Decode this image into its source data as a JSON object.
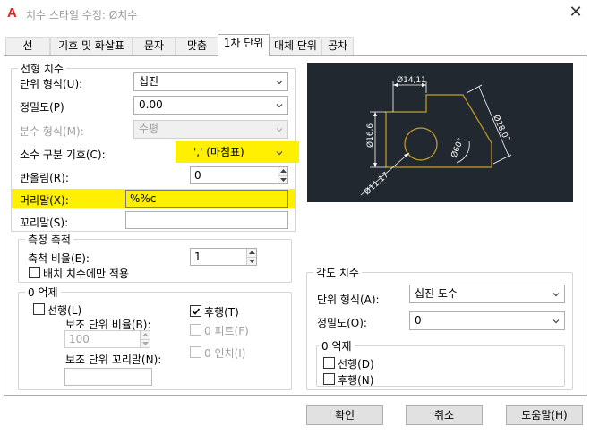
{
  "window": {
    "title": "치수 스타일 수정: Ø치수",
    "close_glyph": "✕"
  },
  "tabs": [
    {
      "label": "선"
    },
    {
      "label": "기호 및 화살표"
    },
    {
      "label": "문자"
    },
    {
      "label": "맞춤"
    },
    {
      "label": "1차 단위"
    },
    {
      "label": "대체 단위"
    },
    {
      "label": "공차"
    }
  ],
  "active_tab": "1차 단위",
  "linear": {
    "legend": "선형 치수",
    "unit_format": {
      "label": "단위 형식(U):",
      "value": "십진"
    },
    "precision": {
      "label": "정밀도(P)",
      "value": "0.00"
    },
    "fraction_format": {
      "label": "분수 형식(M):",
      "value": "수평"
    },
    "decimal_separator": {
      "label": "소수 구분 기호(C):",
      "value": "','  (마침표)"
    },
    "round_off": {
      "label": "반올림(R):",
      "value": "0"
    },
    "prefix": {
      "label": "머리말(X):",
      "value": "%%c"
    },
    "suffix": {
      "label": "꼬리말(S):",
      "value": ""
    }
  },
  "measurement_scale": {
    "legend": "측정 축척",
    "scale_factor": {
      "label": "축척 비율(E):",
      "value": "1"
    },
    "layout_only": {
      "label": "배치 치수에만 적용",
      "checked": false
    }
  },
  "zero_suppression": {
    "legend": "0 억제",
    "leading": {
      "label": "선행(L)",
      "checked": false
    },
    "sub_unit_factor": {
      "label": "보조 단위 비율(B):",
      "value": "100"
    },
    "sub_unit_suffix": {
      "label": "보조 단위 꼬리말(N):",
      "value": ""
    },
    "trailing": {
      "label": "후행(T)",
      "checked": true
    },
    "zero_feet": {
      "label": "0 피트(F)",
      "checked": false
    },
    "zero_inches": {
      "label": "0 인치(I)",
      "checked": false
    }
  },
  "preview": {
    "dims": [
      "14,11",
      "16,6",
      "28,07",
      "60°",
      "11,17"
    ],
    "colors": {
      "background": "#212830",
      "geometry": "#c8a02a",
      "dimension": "#ffffff"
    }
  },
  "angular": {
    "legend": "각도 치수",
    "unit_format": {
      "label": "단위 형식(A):",
      "value": "십진 도수"
    },
    "precision": {
      "label": "정밀도(O):",
      "value": "0"
    },
    "zero_suppression": {
      "legend": "0 억제",
      "leading": {
        "label": "선행(D)",
        "checked": false
      },
      "trailing": {
        "label": "후행(N)",
        "checked": false
      }
    }
  },
  "buttons": {
    "ok": "확인",
    "cancel": "취소",
    "help": "도움말(H)"
  },
  "colors": {
    "highlight": "#ffef00",
    "app_logo": "#e3261d"
  }
}
